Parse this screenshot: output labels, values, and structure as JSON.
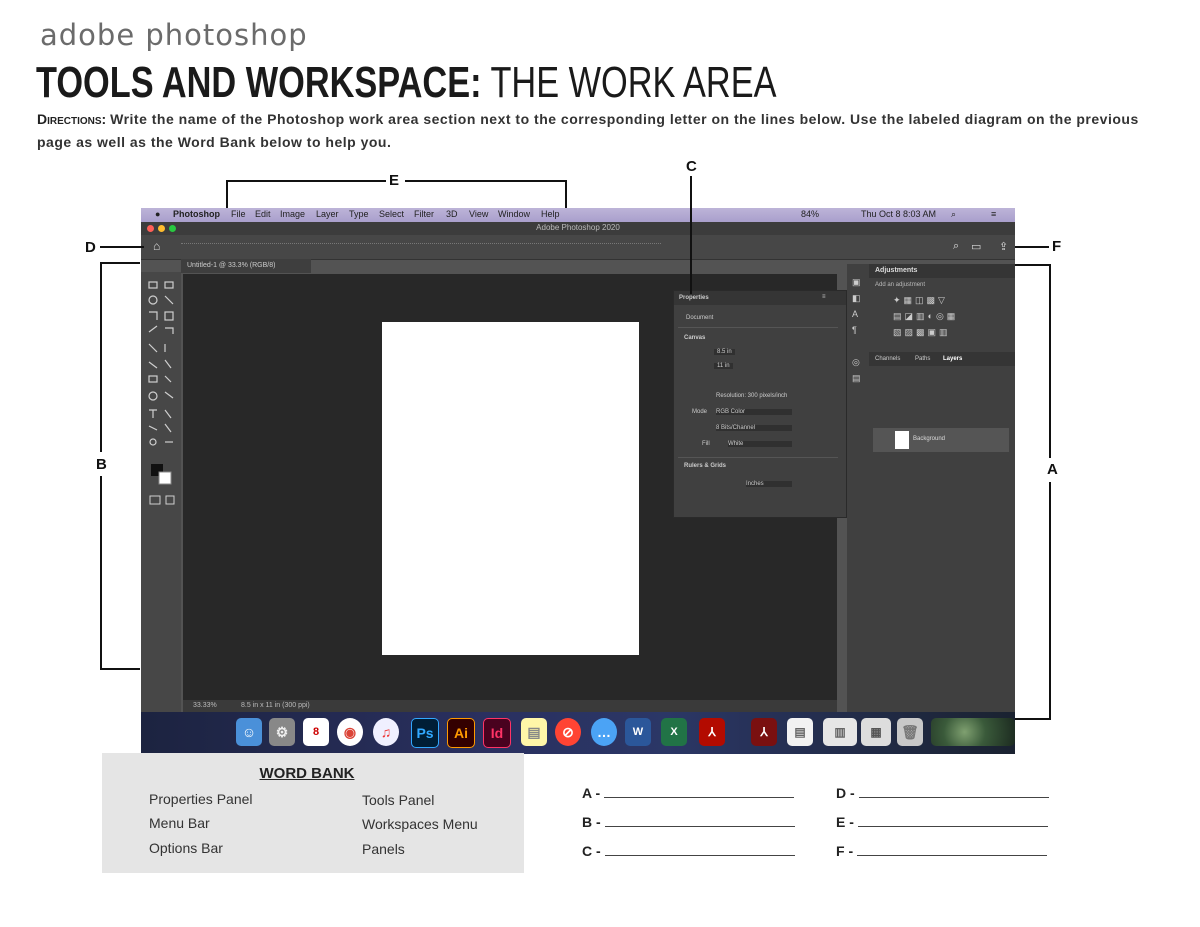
{
  "header": {
    "subtitle": "adobe photoshop",
    "title_bold": "TOOLS AND WORKSPACE:",
    "title_light": "THE WORK AREA"
  },
  "directions": {
    "label": "Directions:",
    "text": "Write the name of the Photoshop work area section next to the corresponding letter on the lines below.  Use the labeled diagram on the previous page as well as the Word Bank below to help you."
  },
  "screenshot": {
    "menu": [
      "Photoshop",
      "File",
      "Edit",
      "Image",
      "Layer",
      "Type",
      "Select",
      "Filter",
      "3D",
      "View",
      "Window",
      "Help"
    ],
    "status_right": "Thu Oct 8  8:03 AM",
    "battery": "84%",
    "app_title": "Adobe Photoshop 2020",
    "doc_tab": "Untitled-1 @ 33.3% (RGB/8)",
    "zoom": "33.33%",
    "doc_size": "8.5 in x 11 in (300 ppi)",
    "properties_title": "Properties",
    "properties_doc": "Document",
    "canvas_label": "Canvas",
    "width_val": "8.5 in",
    "height_val": "11 in",
    "resolution": "Resolution: 300 pixels/inch",
    "mode_label": "Mode",
    "mode_val": "RGB Color",
    "bits_val": "8 Bits/Channel",
    "fill_label": "Fill",
    "fill_val": "White",
    "rulers_label": "Rulers & Grids",
    "units_val": "Inches",
    "adjustments_title": "Adjustments",
    "adjustments_sub": "Add an adjustment",
    "layer_tabs": [
      "Channels",
      "Paths",
      "Layers"
    ],
    "background_layer": "Background",
    "dock_apps": [
      "Ps",
      "Ai",
      "Id"
    ]
  },
  "annotations": {
    "A": "A",
    "B": "B",
    "C": "C",
    "D": "D",
    "E": "E",
    "F": "F"
  },
  "word_bank": {
    "title": "WORD BANK",
    "items": [
      "Properties Panel",
      "Menu Bar",
      "Options Bar",
      "Tools Panel",
      "Workspaces Menu",
      "Panels"
    ]
  },
  "answers": [
    {
      "letter": "A -"
    },
    {
      "letter": "B -"
    },
    {
      "letter": "C -"
    },
    {
      "letter": "D -"
    },
    {
      "letter": "E -"
    },
    {
      "letter": "F -"
    }
  ],
  "colors": {
    "menubar": "#b3a9d4",
    "panel": "#404040",
    "canvas": "#282828",
    "wordbank_bg": "#e5e5e5"
  }
}
